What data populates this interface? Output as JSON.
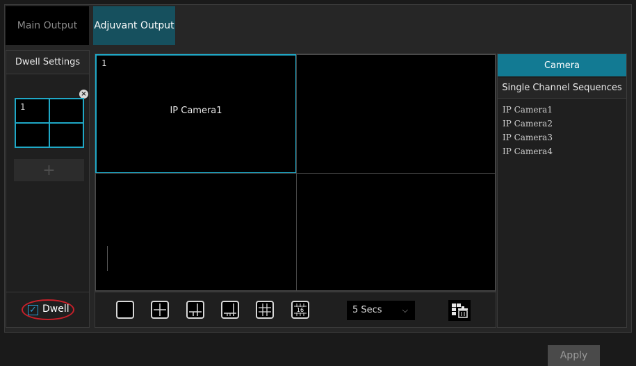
{
  "tabs": {
    "main_output": "Main Output",
    "adjuvant_output": "Adjuvant Output"
  },
  "dwell_settings": {
    "header": "Dwell Settings",
    "mini_layout_number": "1",
    "add_symbol": "+",
    "close_symbol": "×"
  },
  "view": {
    "cell_number": "1",
    "camera_name": "IP Camera1"
  },
  "camera_panel": {
    "header": "Camera",
    "sequences_header": "Single Channel Sequences",
    "items": [
      "IP Camera1",
      "IP Camera2",
      "IP Camera3",
      "IP Camera4"
    ]
  },
  "dwell_toggle": {
    "label": "Dwell",
    "checked": true,
    "check_symbol": "✓"
  },
  "toolbar": {
    "layout_buttons": [
      "layout-1-icon",
      "layout-4-icon",
      "layout-6-icon",
      "layout-8-icon",
      "layout-9-icon",
      "layout-16-icon"
    ],
    "layout_16_label": "16",
    "interval_value": "5 Secs",
    "chevron": "⌵",
    "clear_icon": "trash-icon"
  },
  "apply_label": "Apply",
  "colors": {
    "accent": "#1fa8c6",
    "tab_active": "#16505e",
    "camera_header": "#127a93",
    "highlight_ring": "#c8202a"
  }
}
